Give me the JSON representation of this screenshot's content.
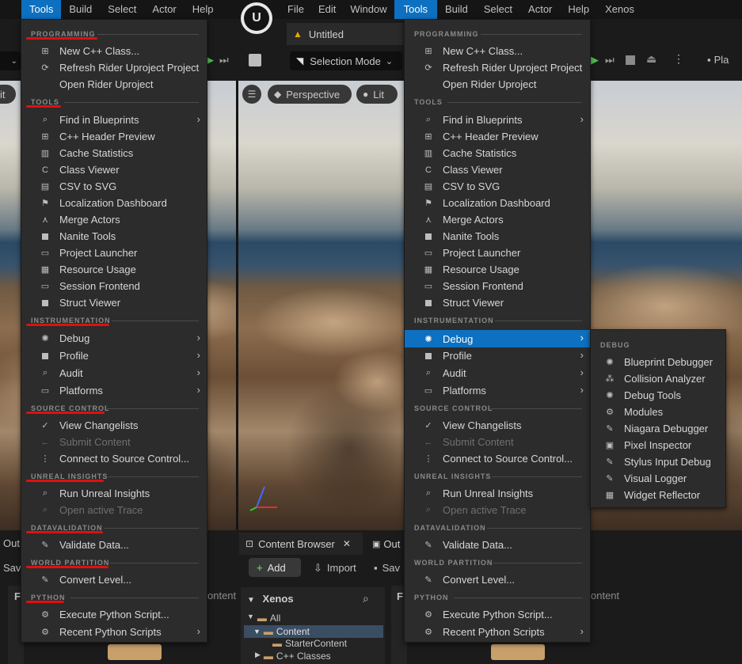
{
  "colors": {
    "accent": "#0e70c0",
    "menu_bg": "#2c2c2c",
    "annotation": "#e01010",
    "warning": "#e8a800"
  },
  "left_menubar": {
    "items": [
      {
        "label": "Tools",
        "active": true
      },
      {
        "label": "Build"
      },
      {
        "label": "Select"
      },
      {
        "label": "Actor"
      },
      {
        "label": "Help"
      }
    ]
  },
  "right_menubar": {
    "items": [
      {
        "label": "File"
      },
      {
        "label": "Edit"
      },
      {
        "label": "Window"
      },
      {
        "label": "Tools",
        "active": true
      },
      {
        "label": "Build"
      },
      {
        "label": "Select"
      },
      {
        "label": "Actor"
      },
      {
        "label": "Help"
      },
      {
        "label": "Xenos"
      }
    ]
  },
  "editor": {
    "project_tab": "Untitled",
    "selection_mode": "Selection Mode",
    "viewport": {
      "perspective": "Perspective",
      "lit": "Lit"
    },
    "left_viewport_partial": "it",
    "right_toolbar_partial": "Pla",
    "content_browser": {
      "tab": "Content Browser",
      "output_tab_partial": "Out",
      "add": "Add",
      "import": "Import",
      "save_partial": "Sav",
      "root": "Xenos",
      "tree": [
        "All",
        "Content",
        "StarterContent",
        "C++ Classes"
      ],
      "filter_partial": "F",
      "content_partial": "ontent"
    },
    "left_bottom": {
      "output_partial": "Out",
      "save_partial": "Sav",
      "filter_partial": "F",
      "content_partial": "ontent"
    }
  },
  "tools_menu": {
    "sections": {
      "programming": "PROGRAMMING",
      "tools": "TOOLS",
      "instrumentation": "INSTRUMENTATION",
      "source_control": "SOURCE CONTROL",
      "unreal_insights": "UNREAL INSIGHTS",
      "datavalidation": "DATAVALIDATION",
      "world_partition": "WORLD PARTITION",
      "python": "PYTHON"
    },
    "items": {
      "new_cpp_class": "New C++ Class...",
      "refresh_rider": "Refresh Rider Uproject Project",
      "open_rider": "Open Rider Uproject",
      "find_in_blueprints": "Find in Blueprints",
      "cpp_header_preview": "C++ Header Preview",
      "cache_statistics": "Cache Statistics",
      "class_viewer": "Class Viewer",
      "csv_to_svg": "CSV to SVG",
      "localization_dashboard": "Localization Dashboard",
      "merge_actors": "Merge Actors",
      "nanite_tools": "Nanite Tools",
      "project_launcher": "Project Launcher",
      "resource_usage": "Resource Usage",
      "session_frontend": "Session Frontend",
      "struct_viewer": "Struct Viewer",
      "debug": "Debug",
      "profile": "Profile",
      "audit": "Audit",
      "platforms": "Platforms",
      "view_changelists": "View Changelists",
      "submit_content": "Submit Content",
      "connect_source_control": "Connect to Source Control...",
      "run_unreal_insights": "Run Unreal Insights",
      "open_active_trace": "Open active Trace",
      "validate_data": "Validate Data...",
      "convert_level": "Convert Level...",
      "execute_python": "Execute Python Script...",
      "recent_python": "Recent Python Scripts"
    }
  },
  "debug_submenu": {
    "section": "DEBUG",
    "items": [
      {
        "label": "Blueprint Debugger",
        "icon": "bug-icon"
      },
      {
        "label": "Collision Analyzer",
        "icon": "collision-icon"
      },
      {
        "label": "Debug Tools",
        "icon": "debug-icon"
      },
      {
        "label": "Modules",
        "icon": "modules-icon"
      },
      {
        "label": "Niagara Debugger",
        "icon": "niagara-icon"
      },
      {
        "label": "Pixel Inspector",
        "icon": "pixel-icon"
      },
      {
        "label": "Stylus Input Debug",
        "icon": "stylus-icon"
      },
      {
        "label": "Visual Logger",
        "icon": "logger-icon"
      },
      {
        "label": "Widget Reflector",
        "icon": "reflector-icon"
      }
    ]
  }
}
